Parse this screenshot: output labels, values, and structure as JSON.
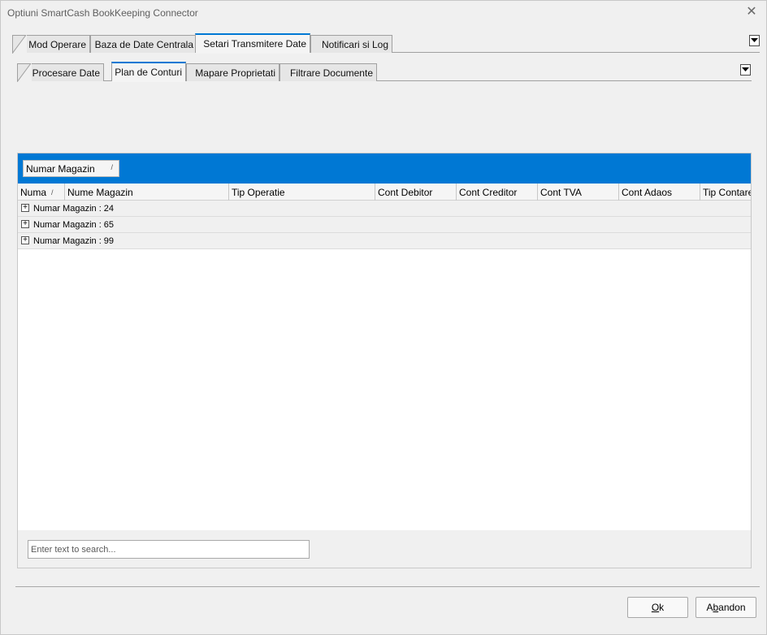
{
  "window": {
    "title": "Optiuni SmartCash BookKeeping Connector",
    "close_glyph": "✕"
  },
  "main_tabs": [
    {
      "label": "Mod Operare",
      "active": false
    },
    {
      "label": "Baza de Date Centrala",
      "active": false
    },
    {
      "label": "Setari Transmitere Date",
      "active": true
    },
    {
      "label": "Notificari si Log",
      "active": false
    }
  ],
  "sub_tabs": [
    {
      "label": "Procesare Date",
      "active": false
    },
    {
      "label": "Plan de Conturi",
      "active": true
    },
    {
      "label": "Mapare Proprietati",
      "active": false
    },
    {
      "label": "Filtrare Documente",
      "active": false
    }
  ],
  "grid": {
    "group_chip": {
      "label": "Numar Magazin",
      "sort_glyph": "/"
    },
    "columns": [
      {
        "label": "Numa",
        "sort_glyph": "/"
      },
      {
        "label": "Nume Magazin"
      },
      {
        "label": "Tip Operatie"
      },
      {
        "label": "Cont Debitor"
      },
      {
        "label": "Cont Creditor"
      },
      {
        "label": "Cont TVA"
      },
      {
        "label": "Cont Adaos"
      },
      {
        "label": "Tip Contare"
      }
    ],
    "group_rows": [
      {
        "label": "Numar Magazin : 24",
        "expander": "+"
      },
      {
        "label": "Numar Magazin : 65",
        "expander": "+"
      },
      {
        "label": "Numar Magazin : 99",
        "expander": "+"
      }
    ],
    "search": {
      "placeholder": "Enter text to search...",
      "value": ""
    }
  },
  "buttons": {
    "ok": {
      "mnemonic": "O",
      "rest": "k"
    },
    "abandon": {
      "prefix": "A",
      "mnemonic": "b",
      "rest": "andon"
    }
  },
  "colors": {
    "accent": "#0078d4",
    "window_bg": "#f0f0f0"
  },
  "icons": [
    "close-icon",
    "dropdown-arrow-icon",
    "expand-plus-icon",
    "sort-indicator-icon"
  ]
}
